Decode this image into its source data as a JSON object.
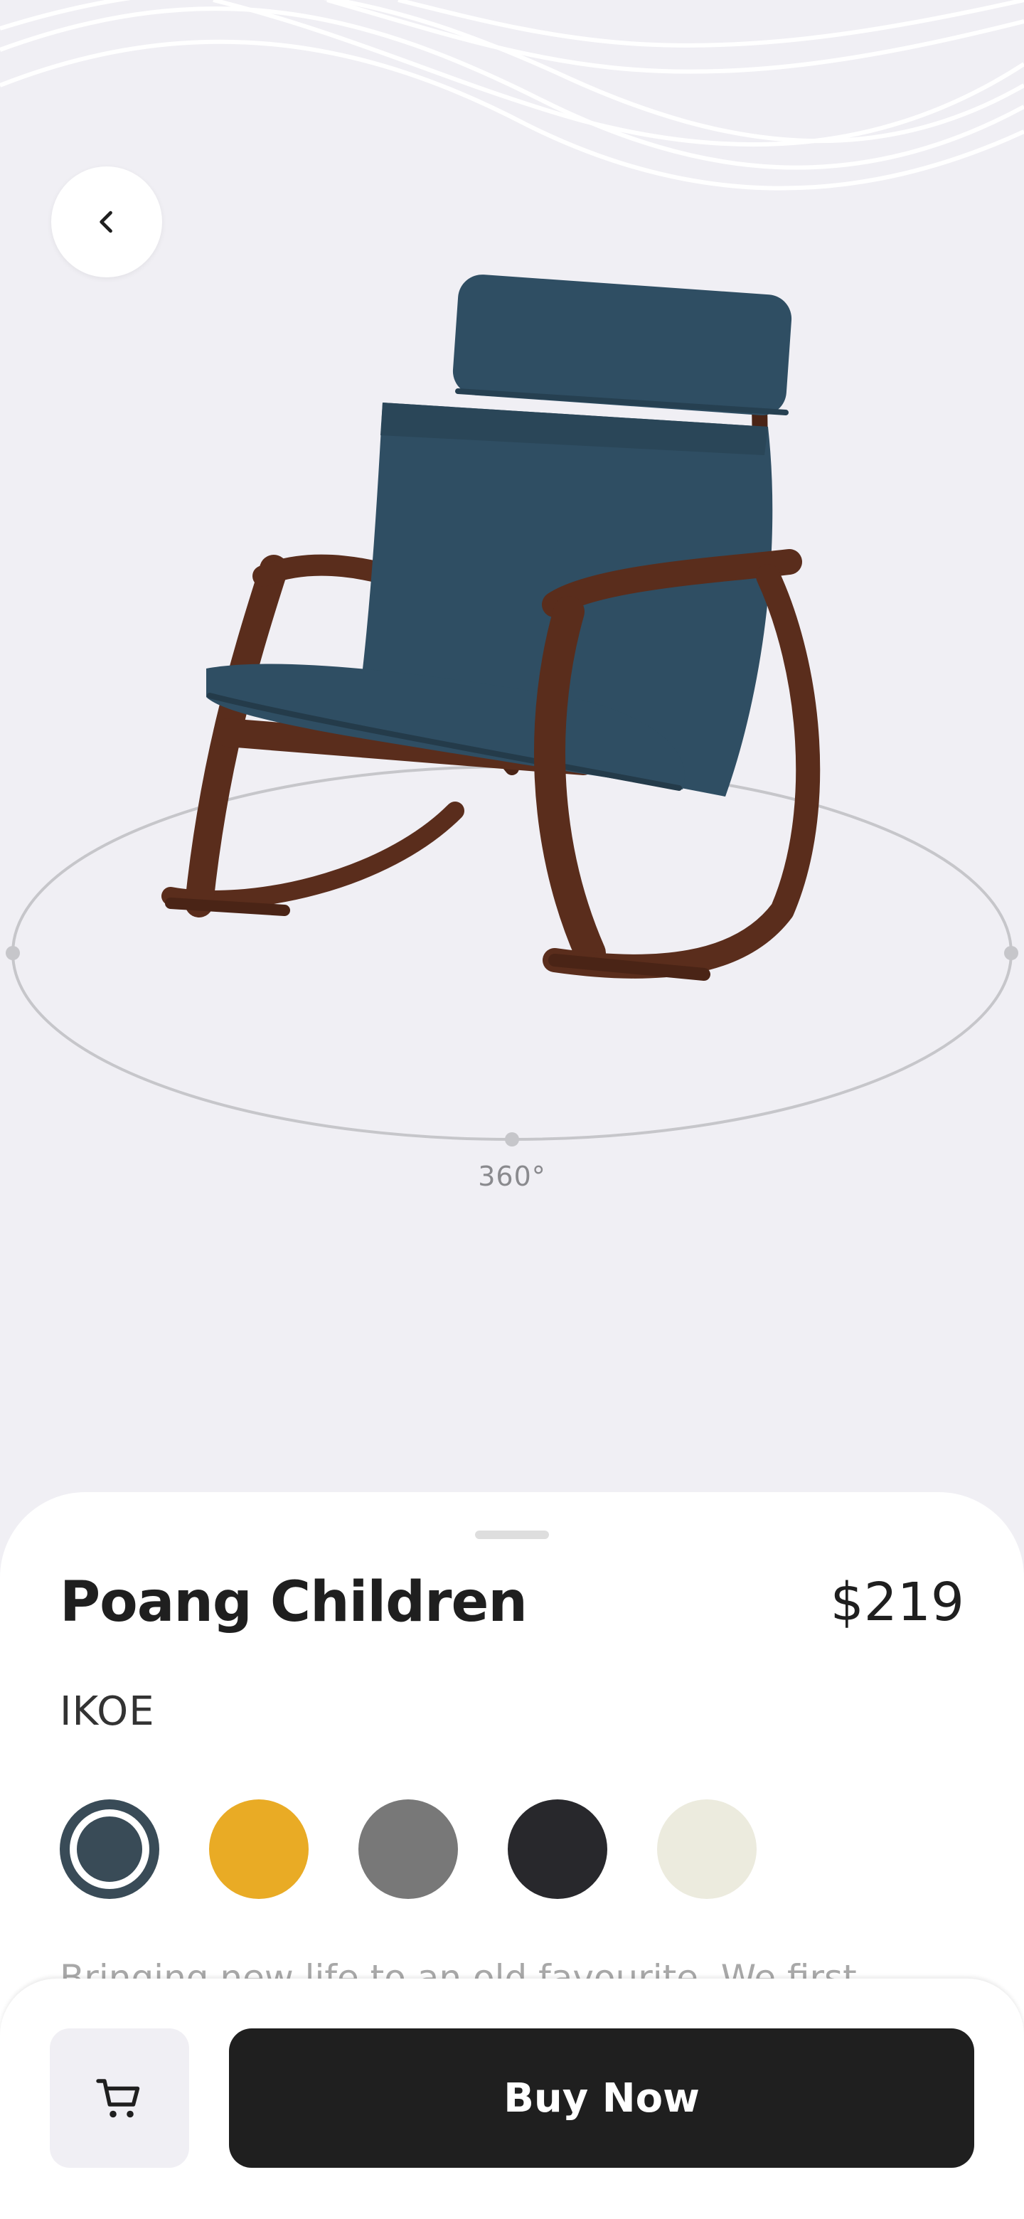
{
  "header": {
    "back_icon": "chevron-left-icon"
  },
  "viewer": {
    "rotation_label": "360°"
  },
  "product": {
    "name": "Poang Children",
    "price": "$219",
    "brand": "IKOE",
    "description": "Bringing new life to an old favourite. We first"
  },
  "colors": [
    {
      "hex": "#394b57",
      "selected": true
    },
    {
      "hex": "#e9ab25",
      "selected": false
    },
    {
      "hex": "#787878",
      "selected": false
    },
    {
      "hex": "#28282c",
      "selected": false
    },
    {
      "hex": "#ecebde",
      "selected": false
    }
  ],
  "actions": {
    "cart_icon": "cart-icon",
    "buy_label": "Buy Now"
  },
  "theme": {
    "background": "#f0eff4",
    "primary": "#1f1f1f",
    "upholstery": "#2f4e63",
    "frame": "#5a2d1c"
  }
}
